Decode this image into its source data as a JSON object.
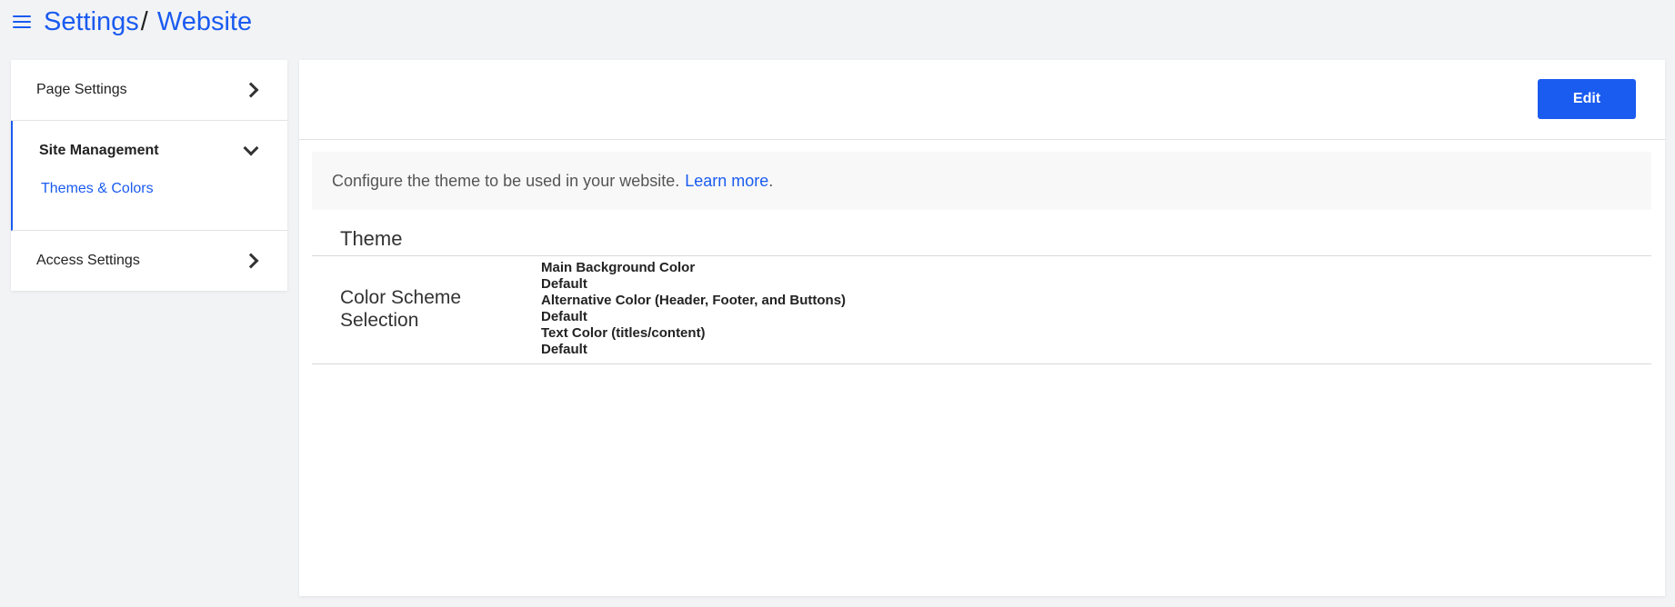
{
  "header": {
    "menu_icon": "hamburger-menu-icon",
    "breadcrumb": [
      "Settings",
      "/",
      "Website"
    ]
  },
  "sidebar": {
    "sections": [
      {
        "label": "Page Settings",
        "icon": "chevron-right-icon"
      },
      {
        "label": "Site Management",
        "icon": "chevron-down-icon",
        "items": [
          {
            "label": "Themes & Colors"
          }
        ]
      },
      {
        "label": "Access Settings",
        "icon": "chevron-right-icon"
      }
    ]
  },
  "main": {
    "edit_label": "Edit",
    "info_text": "Configure the theme to be used in your website.",
    "learn_more": "Learn more",
    "info_period": ".",
    "section_title": "Theme",
    "row": {
      "label": "Color Scheme Selection",
      "fields": [
        {
          "name": "Main Background Color",
          "value": "Default"
        },
        {
          "name": "Alternative Color (Header, Footer, and Buttons)",
          "value": "Default"
        },
        {
          "name": "Text Color (titles/content)",
          "value": "Default"
        }
      ]
    }
  },
  "colors": {
    "accent": "#1a5bf0",
    "background": "#f2f3f5",
    "panel": "#ffffff"
  }
}
